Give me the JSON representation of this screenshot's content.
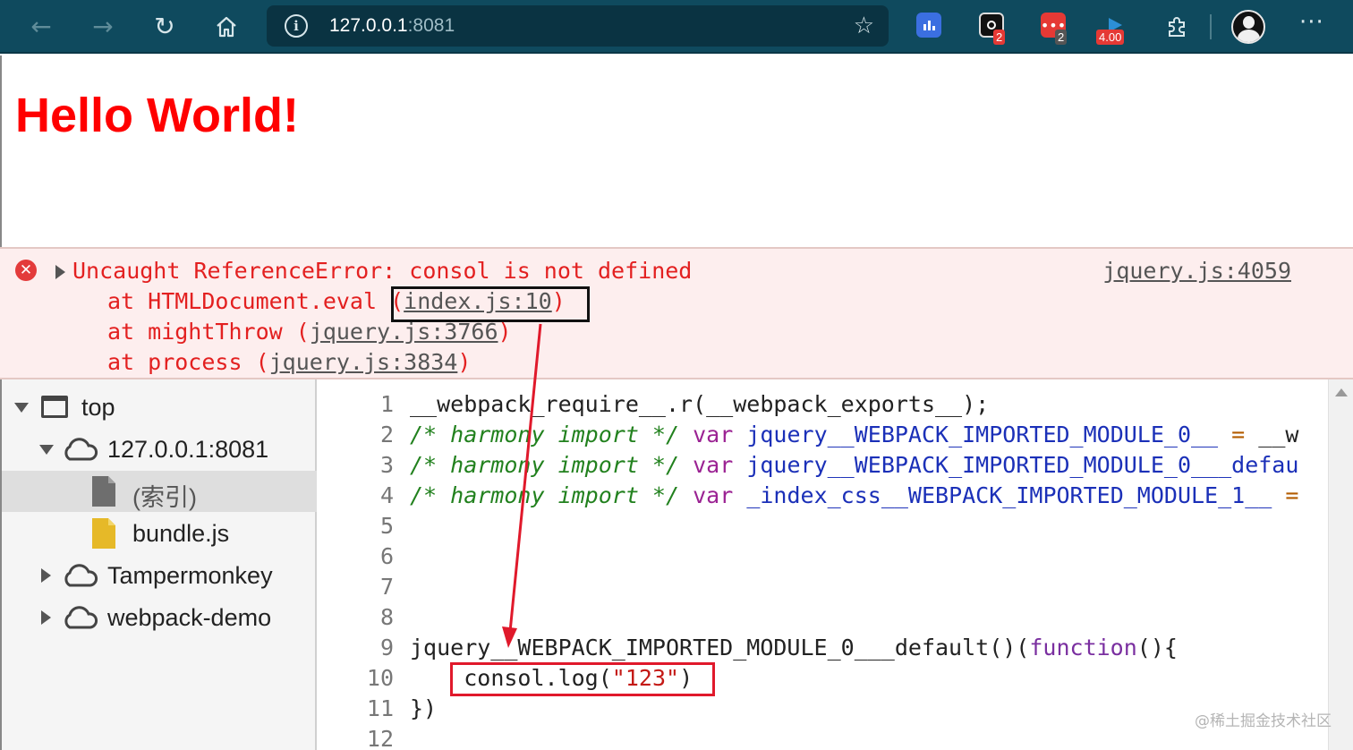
{
  "browser": {
    "url_host": "127.0.0.1",
    "url_port": ":8081",
    "extensions": [
      {
        "name": "bar-chart-extension",
        "badge": ""
      },
      {
        "name": "record-extension",
        "badge": "2"
      },
      {
        "name": "comment-extension",
        "badge": "2"
      },
      {
        "name": "speed-extension",
        "badge": "4.00"
      }
    ],
    "colors": {
      "toolbar": "#0f4a5e",
      "address_bar": "#0a3342"
    }
  },
  "page": {
    "heading": "Hello World!",
    "heading_color": "#ff0000"
  },
  "console": {
    "error_message": "Uncaught ReferenceError: consol is not defined",
    "source_link": "jquery.js:4059",
    "stack": [
      {
        "prefix": "at HTMLDocument.eval (",
        "link": "index.js:10",
        "suffix": ")"
      },
      {
        "prefix": "at mightThrow (",
        "link": "jquery.js:3766",
        "suffix": ")"
      },
      {
        "prefix": "at process (",
        "link": "jquery.js:3834",
        "suffix": ")"
      }
    ]
  },
  "file_tree": {
    "top": "top",
    "origin": "127.0.0.1:8081",
    "index_file": "(索引)",
    "bundle_file": "bundle.js",
    "tampermonkey": "Tampermonkey",
    "webpack_demo": "webpack-demo"
  },
  "code": {
    "line_numbers": [
      "1",
      "2",
      "3",
      "4",
      "5",
      "6",
      "7",
      "8",
      "9",
      "10",
      "11",
      "12"
    ],
    "line1": "__webpack_require__.r(__webpack_exports__);",
    "comment": "/* harmony import */",
    "kw_var": "var",
    "line2_name": "jquery__WEBPACK_IMPORTED_MODULE_0__",
    "line2_op": "=",
    "line2_rest": "__w",
    "line3_name": "jquery__WEBPACK_IMPORTED_MODULE_0___defau",
    "line4_name": "_index_css__WEBPACK_IMPORTED_MODULE_1__",
    "line4_op": "=",
    "line9_prefix": "jquery__WEBPACK_IMPORTED_MODULE_0___default()(",
    "line9_fn": "function",
    "line9_suffix": "(){",
    "line10_prefix": "consol.log(",
    "line10_str": "\"123\"",
    "line10_suffix": ")",
    "line11": "})"
  },
  "watermark": "@稀土掘金技术社区"
}
